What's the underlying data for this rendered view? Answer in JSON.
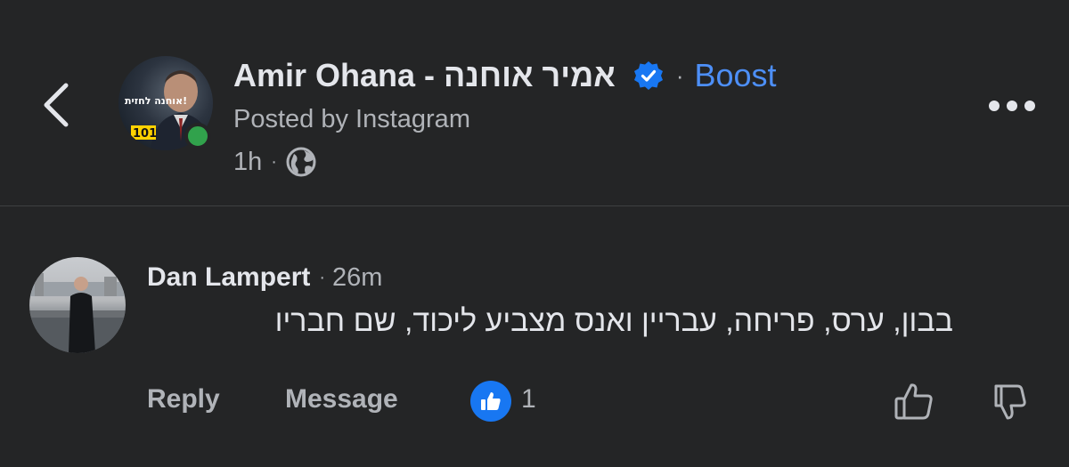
{
  "post_header": {
    "page_name": "Amir Ohana - אמיר  אוחנה",
    "separator": "·",
    "boost_label": "Boost",
    "posted_by": "Posted by Instagram",
    "time": "1h",
    "meta_separator": "·",
    "avatar_logo_text": "אוחנה לחזית!",
    "avatar_badge": "101"
  },
  "comment": {
    "author": "Dan Lampert",
    "separator": "·",
    "time": "26m",
    "text": "בבון, ערס, פריחה, עבריין ואנס מצביע ליכוד, שם חבריו"
  },
  "actions": {
    "reply_label": "Reply",
    "message_label": "Message",
    "like_count": "1"
  },
  "colors": {
    "background": "#242526",
    "accent": "#4d8ff7",
    "verified": "#1877f2",
    "online": "#31a24c",
    "secondary_text": "#b0b3b8"
  },
  "icons": {
    "back": "chevron-left-icon",
    "verified": "verified-badge-icon",
    "globe": "globe-icon",
    "more": "more-horizontal-icon",
    "like": "thumbs-up-icon",
    "upvote": "upvote-icon",
    "downvote": "downvote-icon"
  }
}
